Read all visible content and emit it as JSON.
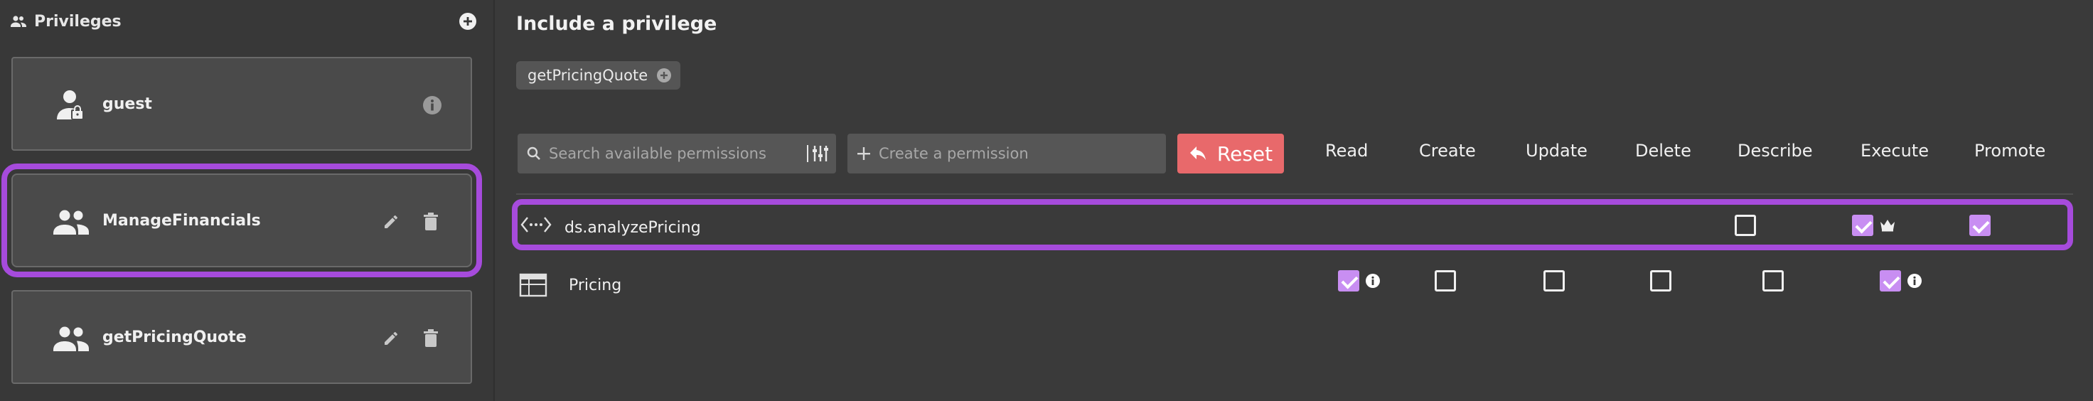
{
  "sidebar": {
    "title": "Privileges",
    "header_icon": "people-icon",
    "add_icon": "add-circle-icon",
    "items": [
      {
        "name": "guest",
        "icon": "locked-user-icon",
        "actions": [
          "info-icon"
        ],
        "selected": false
      },
      {
        "name": "ManageFinancials",
        "icon": "group-icon",
        "actions": [
          "edit-icon",
          "delete-icon"
        ],
        "selected": true
      },
      {
        "name": "getPricingQuote",
        "icon": "group-icon",
        "actions": [
          "edit-icon",
          "delete-icon"
        ],
        "selected": false
      }
    ]
  },
  "main": {
    "title": "Include a privilege",
    "included": [
      {
        "label": "getPricingQuote",
        "icon": "add-circle-icon"
      }
    ],
    "search": {
      "placeholder": "Search available permissions"
    },
    "create": {
      "placeholder": "Create a permission"
    },
    "reset_label": "Reset",
    "columns": [
      "Read",
      "Create",
      "Update",
      "Delete",
      "Describe",
      "Execute",
      "Promote"
    ],
    "rows": [
      {
        "name": "ds.analyzePricing",
        "icon": "api-endpoint-icon",
        "selected": true,
        "perms": {
          "Describe": false,
          "Execute": true,
          "Promote": true
        },
        "badges": {
          "Execute": "crown-icon"
        }
      },
      {
        "name": "Pricing",
        "icon": "table-icon",
        "selected": false,
        "perms": {
          "Read": true,
          "Create": false,
          "Update": false,
          "Delete": false,
          "Describe": false,
          "Execute": true
        },
        "badges": {
          "Read": "info-icon",
          "Execute": "info-icon"
        }
      }
    ]
  },
  "colors": {
    "accent_purple": "#a64bdc",
    "checkbox_checked": "#c88ef2",
    "reset_button": "#e8696b",
    "background": "#3a3a3a",
    "card": "#4a4a4a"
  }
}
